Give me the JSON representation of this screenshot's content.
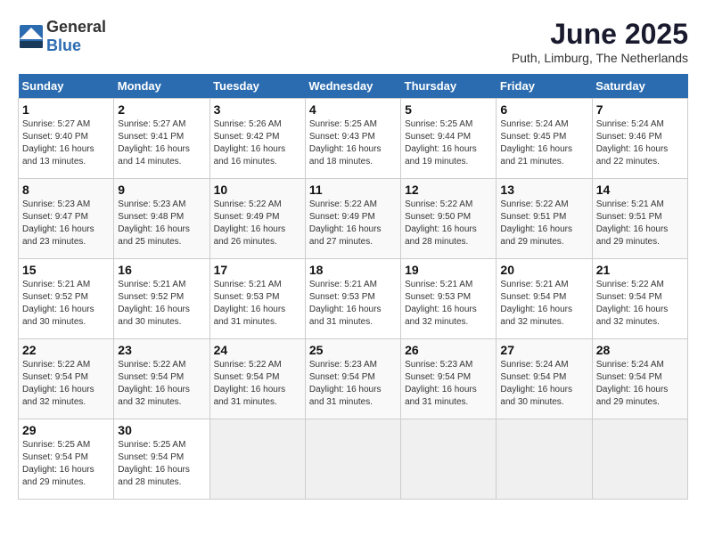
{
  "logo": {
    "text_general": "General",
    "text_blue": "Blue"
  },
  "title": "June 2025",
  "subtitle": "Puth, Limburg, The Netherlands",
  "days_of_week": [
    "Sunday",
    "Monday",
    "Tuesday",
    "Wednesday",
    "Thursday",
    "Friday",
    "Saturday"
  ],
  "weeks": [
    [
      {
        "day": "1",
        "sunrise": "5:27 AM",
        "sunset": "9:40 PM",
        "daylight": "16 hours and 13 minutes."
      },
      {
        "day": "2",
        "sunrise": "5:27 AM",
        "sunset": "9:41 PM",
        "daylight": "16 hours and 14 minutes."
      },
      {
        "day": "3",
        "sunrise": "5:26 AM",
        "sunset": "9:42 PM",
        "daylight": "16 hours and 16 minutes."
      },
      {
        "day": "4",
        "sunrise": "5:25 AM",
        "sunset": "9:43 PM",
        "daylight": "16 hours and 18 minutes."
      },
      {
        "day": "5",
        "sunrise": "5:25 AM",
        "sunset": "9:44 PM",
        "daylight": "16 hours and 19 minutes."
      },
      {
        "day": "6",
        "sunrise": "5:24 AM",
        "sunset": "9:45 PM",
        "daylight": "16 hours and 21 minutes."
      },
      {
        "day": "7",
        "sunrise": "5:24 AM",
        "sunset": "9:46 PM",
        "daylight": "16 hours and 22 minutes."
      }
    ],
    [
      {
        "day": "8",
        "sunrise": "5:23 AM",
        "sunset": "9:47 PM",
        "daylight": "16 hours and 23 minutes."
      },
      {
        "day": "9",
        "sunrise": "5:23 AM",
        "sunset": "9:48 PM",
        "daylight": "16 hours and 25 minutes."
      },
      {
        "day": "10",
        "sunrise": "5:22 AM",
        "sunset": "9:49 PM",
        "daylight": "16 hours and 26 minutes."
      },
      {
        "day": "11",
        "sunrise": "5:22 AM",
        "sunset": "9:49 PM",
        "daylight": "16 hours and 27 minutes."
      },
      {
        "day": "12",
        "sunrise": "5:22 AM",
        "sunset": "9:50 PM",
        "daylight": "16 hours and 28 minutes."
      },
      {
        "day": "13",
        "sunrise": "5:22 AM",
        "sunset": "9:51 PM",
        "daylight": "16 hours and 29 minutes."
      },
      {
        "day": "14",
        "sunrise": "5:21 AM",
        "sunset": "9:51 PM",
        "daylight": "16 hours and 29 minutes."
      }
    ],
    [
      {
        "day": "15",
        "sunrise": "5:21 AM",
        "sunset": "9:52 PM",
        "daylight": "16 hours and 30 minutes."
      },
      {
        "day": "16",
        "sunrise": "5:21 AM",
        "sunset": "9:52 PM",
        "daylight": "16 hours and 30 minutes."
      },
      {
        "day": "17",
        "sunrise": "5:21 AM",
        "sunset": "9:53 PM",
        "daylight": "16 hours and 31 minutes."
      },
      {
        "day": "18",
        "sunrise": "5:21 AM",
        "sunset": "9:53 PM",
        "daylight": "16 hours and 31 minutes."
      },
      {
        "day": "19",
        "sunrise": "5:21 AM",
        "sunset": "9:53 PM",
        "daylight": "16 hours and 32 minutes."
      },
      {
        "day": "20",
        "sunrise": "5:21 AM",
        "sunset": "9:54 PM",
        "daylight": "16 hours and 32 minutes."
      },
      {
        "day": "21",
        "sunrise": "5:22 AM",
        "sunset": "9:54 PM",
        "daylight": "16 hours and 32 minutes."
      }
    ],
    [
      {
        "day": "22",
        "sunrise": "5:22 AM",
        "sunset": "9:54 PM",
        "daylight": "16 hours and 32 minutes."
      },
      {
        "day": "23",
        "sunrise": "5:22 AM",
        "sunset": "9:54 PM",
        "daylight": "16 hours and 32 minutes."
      },
      {
        "day": "24",
        "sunrise": "5:22 AM",
        "sunset": "9:54 PM",
        "daylight": "16 hours and 31 minutes."
      },
      {
        "day": "25",
        "sunrise": "5:23 AM",
        "sunset": "9:54 PM",
        "daylight": "16 hours and 31 minutes."
      },
      {
        "day": "26",
        "sunrise": "5:23 AM",
        "sunset": "9:54 PM",
        "daylight": "16 hours and 31 minutes."
      },
      {
        "day": "27",
        "sunrise": "5:24 AM",
        "sunset": "9:54 PM",
        "daylight": "16 hours and 30 minutes."
      },
      {
        "day": "28",
        "sunrise": "5:24 AM",
        "sunset": "9:54 PM",
        "daylight": "16 hours and 29 minutes."
      }
    ],
    [
      {
        "day": "29",
        "sunrise": "5:25 AM",
        "sunset": "9:54 PM",
        "daylight": "16 hours and 29 minutes."
      },
      {
        "day": "30",
        "sunrise": "5:25 AM",
        "sunset": "9:54 PM",
        "daylight": "16 hours and 28 minutes."
      },
      null,
      null,
      null,
      null,
      null
    ]
  ]
}
